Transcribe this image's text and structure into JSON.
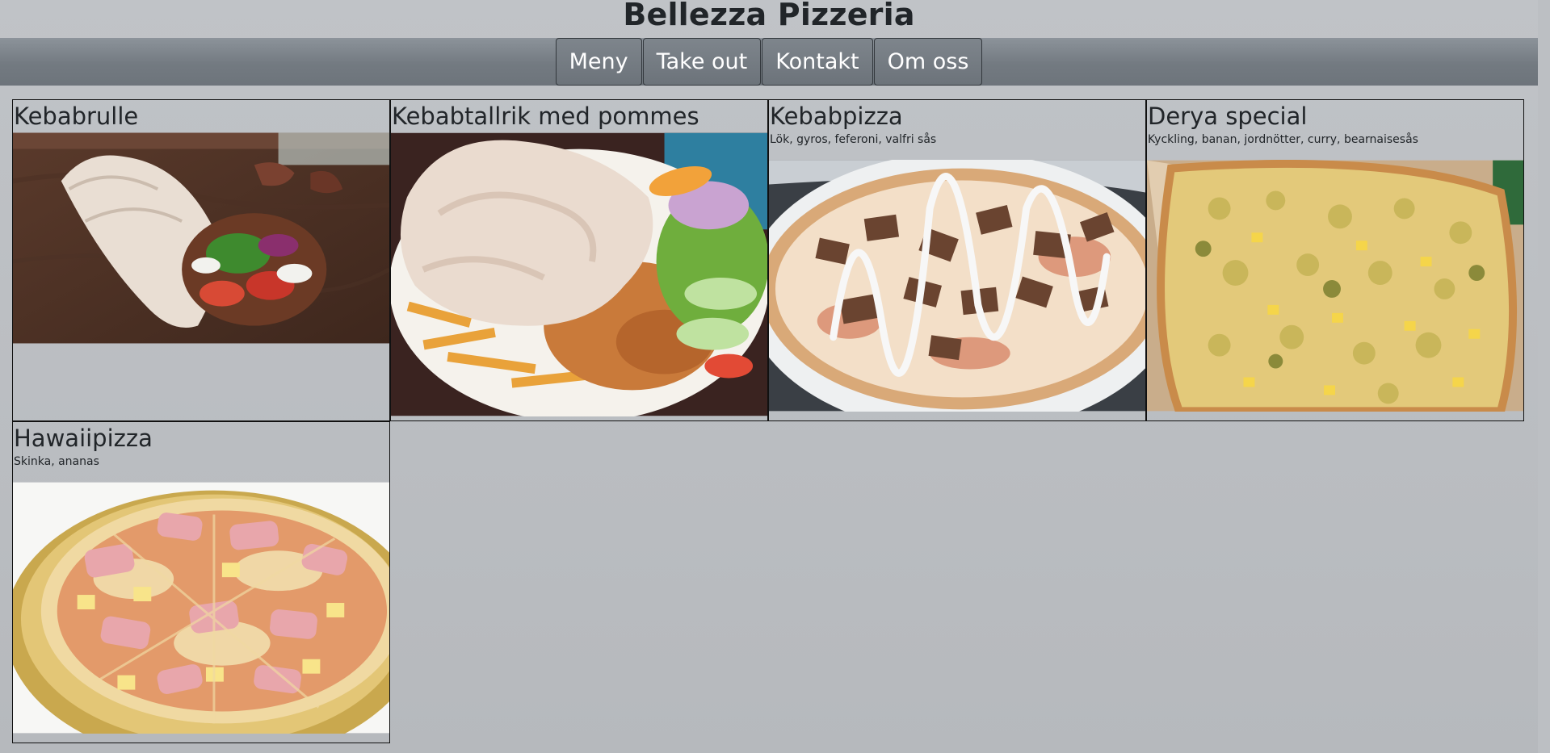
{
  "site": {
    "title": "Bellezza Pizzeria"
  },
  "nav": {
    "items": [
      {
        "label": "Meny"
      },
      {
        "label": "Take out"
      },
      {
        "label": "Kontakt"
      },
      {
        "label": "Om oss"
      }
    ]
  },
  "menu": {
    "items": [
      {
        "title": "Kebabrulle",
        "description": "",
        "image": "kebab-wrap-photo"
      },
      {
        "title": "Kebabtallrik med pommes",
        "description": "",
        "image": "kebab-plate-photo"
      },
      {
        "title": "Kebabpizza",
        "description": "Lök, gyros, feferoni, valfri sås",
        "image": "kebab-pizza-photo"
      },
      {
        "title": "Derya special",
        "description": "Kyckling, banan, jordnötter, curry, bearnaisesås",
        "image": "derya-pizza-photo"
      },
      {
        "title": "Hawaiipizza",
        "description": "Skinka, ananas",
        "image": "hawaii-pizza-photo"
      }
    ]
  },
  "colors": {
    "background": "#bcbfc3",
    "nav_bar": "#737a81",
    "nav_text": "#ffffff"
  }
}
